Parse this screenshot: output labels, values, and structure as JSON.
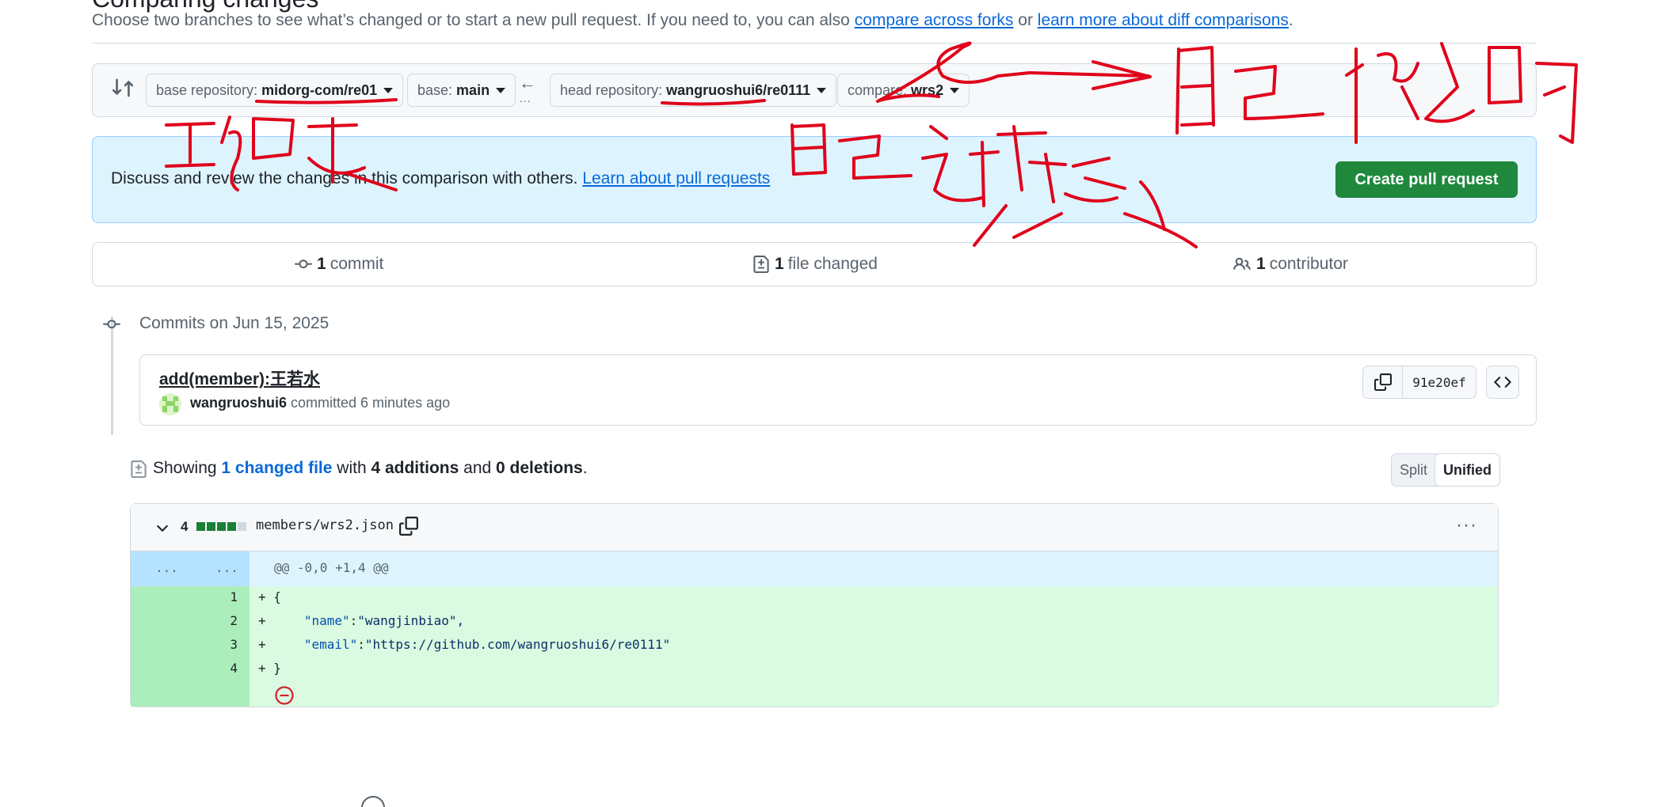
{
  "page": {
    "heading_fragment": "Comparing changes",
    "subtitle_prefix": "Choose two branches to see what’s changed or to start a new pull request. If you need to, you can also ",
    "subtitle_link1": "compare across forks",
    "subtitle_mid": " or ",
    "subtitle_link2": "learn more about diff comparisons",
    "subtitle_end": "."
  },
  "compare": {
    "base_repo_label": "base repository:",
    "base_repo_value": "midorg-com/re01",
    "base_label": "base:",
    "base_value": "main",
    "swap_arrow": "←",
    "swap_dots": "...",
    "head_repo_label": "head repository:",
    "head_repo_value": "wangruoshui6/re0111",
    "compare_label": "compare:",
    "compare_value": "wrs2"
  },
  "banner": {
    "text": "Discuss and review the changes in this comparison with others. ",
    "link": "Learn about pull requests",
    "button": "Create pull request"
  },
  "stats": {
    "commits_count": "1",
    "commits_label": "commit",
    "files_count": "1",
    "files_label": "file changed",
    "contributors_count": "1",
    "contributors_label": "contributor"
  },
  "commits": {
    "date_header": "Commits on Jun 15, 2025",
    "items": [
      {
        "title": "add(member):王若水",
        "author": "wangruoshui6",
        "meta": " committed 6 minutes ago",
        "sha": "91e20ef"
      }
    ]
  },
  "showing": {
    "prefix": "Showing ",
    "changed": "1 changed file",
    "with": " with ",
    "additions": "4 additions",
    "and": " and ",
    "deletions": "0 deletions",
    "end": ".",
    "split": "Split",
    "unified": "Unified"
  },
  "diff": {
    "count": "4",
    "filename": "members/wrs2.json",
    "kebab": "···",
    "hunk_dots_old": "...",
    "hunk_dots_new": "...",
    "hunk_header": "@@ -0,0 +1,4 @@",
    "lines": [
      {
        "n": "1",
        "plus": "+",
        "pre": " {",
        "key": "",
        "sep": "",
        "val": ""
      },
      {
        "n": "2",
        "plus": "+",
        "pre": "     ",
        "key": "\"name\"",
        "sep": ":",
        "val": "\"wangjinbiao\","
      },
      {
        "n": "3",
        "plus": "+",
        "pre": "     ",
        "key": "\"email\"",
        "sep": ":",
        "val": "\"https://github.com/wangruoshui6/re0111\""
      },
      {
        "n": "4",
        "plus": "+",
        "pre": " }",
        "key": "",
        "sep": "",
        "val": ""
      }
    ]
  },
  "colors": {
    "annotation": "#e0001b",
    "success": "#1f883d",
    "accent": "#0969da"
  }
}
